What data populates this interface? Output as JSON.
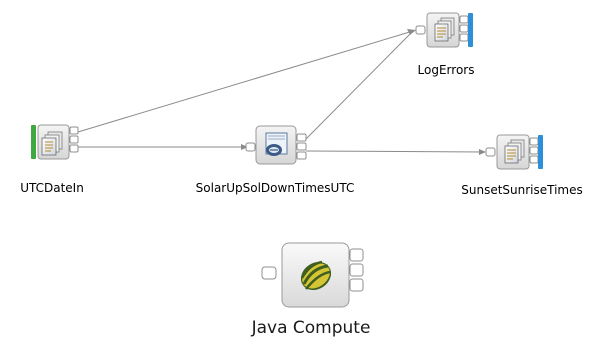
{
  "nodes": {
    "utc_date_in": {
      "label": "UTCDateIn",
      "icon": "mq-input-node-icon",
      "color": "#3fa83f"
    },
    "solar_compute": {
      "label": "SolarUpSolDownTimesUTC",
      "icon": "compute-node-icon"
    },
    "log_errors": {
      "label": "LogErrors",
      "icon": "mq-output-node-icon",
      "color": "#2d8fd8"
    },
    "sunset_sunrise": {
      "label": "SunsetSunriseTimes",
      "icon": "mq-output-node-icon",
      "color": "#2d8fd8"
    }
  },
  "legend": {
    "label": "Java Compute",
    "icon": "java-compute-icon"
  },
  "colors": {
    "connection": "#8a8a8a",
    "terminal": "#c8c8c8",
    "icon_frame": "#9a9a9a"
  }
}
